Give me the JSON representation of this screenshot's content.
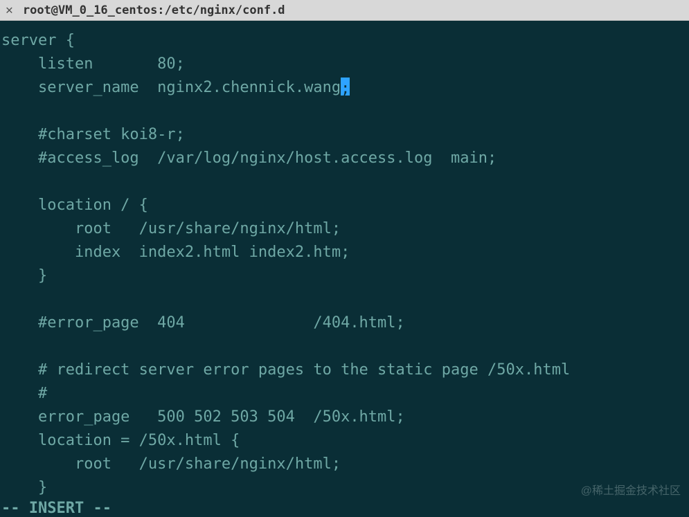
{
  "window": {
    "title": "root@VM_0_16_centos:/etc/nginx/conf.d"
  },
  "editor": {
    "mode_line": "-- INSERT --",
    "cursor_row": 3,
    "cursor_col": 44,
    "lines": [
      "server {",
      "    listen       80;",
      "    server_name  nginx2.chennick.wang;",
      "",
      "    #charset koi8-r;",
      "    #access_log  /var/log/nginx/host.access.log  main;",
      "",
      "    location / {",
      "        root   /usr/share/nginx/html;",
      "        index  index2.html index2.htm;",
      "    }",
      "",
      "    #error_page  404              /404.html;",
      "",
      "    # redirect server error pages to the static page /50x.html",
      "    #",
      "    error_page   500 502 503 504  /50x.html;",
      "    location = /50x.html {",
      "        root   /usr/share/nginx/html;",
      "    }"
    ]
  },
  "watermark": "@稀土掘金技术社区"
}
